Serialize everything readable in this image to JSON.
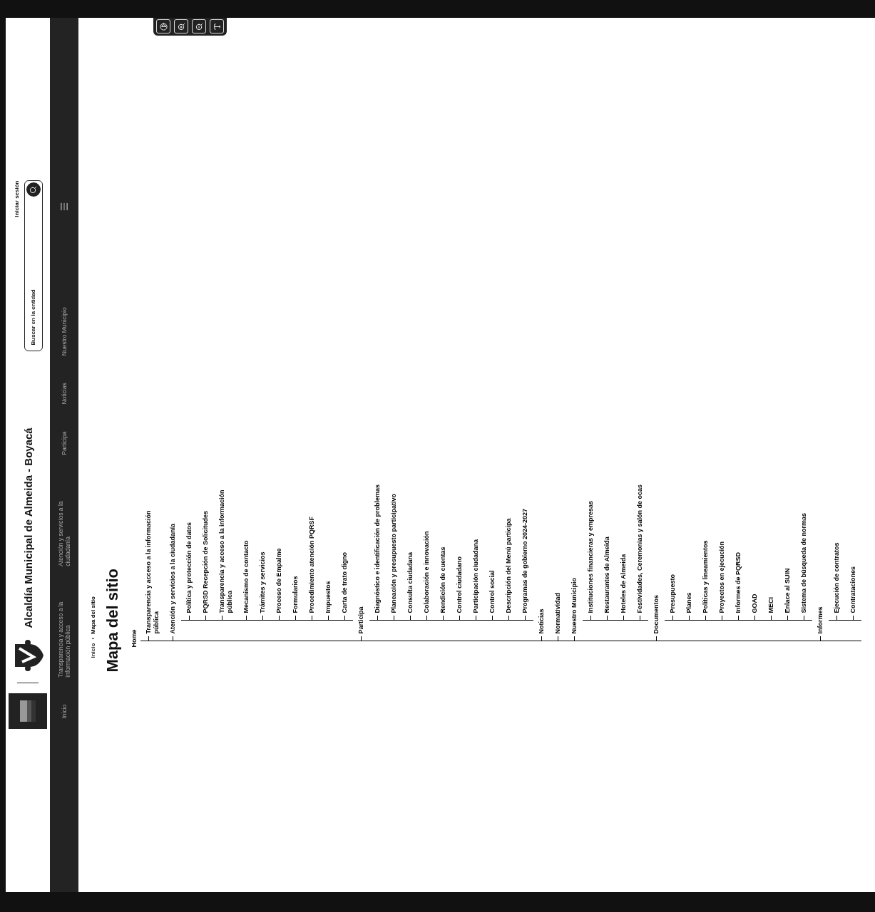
{
  "header": {
    "title": "Alcaldía Municipal de Almeida - Boyacá",
    "login": "Iniciar sesión",
    "search": {
      "placeholder": "Buscar en la entidad"
    }
  },
  "nav": {
    "items": [
      {
        "label": "Inicio"
      },
      {
        "label": "Transparencia y acceso a la información pública"
      },
      {
        "label": "Atención y servicios a la ciudadanía"
      },
      {
        "label": "Participa"
      },
      {
        "label": "Noticias"
      },
      {
        "label": "Nuestro Municipio"
      }
    ]
  },
  "breadcrumb": {
    "separator": "›",
    "items": [
      {
        "label": "Inicio",
        "selected": false
      },
      {
        "label": "Mapa del sitio",
        "selected": true
      }
    ]
  },
  "page_title": "Mapa del sitio",
  "sitemap": {
    "root": "Home",
    "items": [
      {
        "label": "Transparencia y acceso a la información pública",
        "children": []
      },
      {
        "label": "Atención y servicios a la ciudadanía",
        "children": [
          {
            "label": "Política y protección de datos",
            "children": []
          },
          {
            "label": "PQRSD Recepción de Solicitudes",
            "children": []
          },
          {
            "label": "Transparencia y acceso a la información pública",
            "children": []
          },
          {
            "label": "Mecanismo de contacto",
            "children": []
          },
          {
            "label": "Trámites y servicios",
            "children": []
          },
          {
            "label": "Proceso de Empalme",
            "children": []
          },
          {
            "label": "Formularios",
            "children": []
          },
          {
            "label": "Procedimiento atención PQRSF",
            "children": []
          },
          {
            "label": "Impuestos",
            "children": []
          },
          {
            "label": "Carta de trato digno",
            "children": []
          }
        ]
      },
      {
        "label": "Participa",
        "children": [
          {
            "label": "Diagnóstico e identificación de problemas",
            "children": []
          },
          {
            "label": "Planeación y presupuesto participativo",
            "children": []
          },
          {
            "label": "Consulta ciudadana",
            "children": []
          },
          {
            "label": "Colaboración e innovación",
            "children": []
          },
          {
            "label": "Rendición de cuentas",
            "children": []
          },
          {
            "label": "Control ciudadano",
            "children": []
          },
          {
            "label": "Participación ciudadana",
            "children": []
          },
          {
            "label": "Control social",
            "children": []
          },
          {
            "label": "Descripción del Menú participa",
            "children": []
          },
          {
            "label": "Programas de gobierno 2024-2027",
            "children": []
          }
        ]
      },
      {
        "label": "Noticias",
        "children": []
      },
      {
        "label": "Normatividad",
        "children": []
      },
      {
        "label": "Nuestro Municipio",
        "children": [
          {
            "label": "Instituciones financieras y empresas",
            "children": []
          },
          {
            "label": "Restaurantes de Almeida",
            "children": []
          },
          {
            "label": "Hoteles de Almeida",
            "children": []
          },
          {
            "label": "Festividades, Ceremonias y salón de ocas",
            "children": []
          }
        ]
      },
      {
        "label": "Documentos",
        "children": [
          {
            "label": "Presupuesto",
            "children": []
          },
          {
            "label": "Planes",
            "children": []
          },
          {
            "label": "Políticas y lineamientos",
            "children": []
          },
          {
            "label": "Proyectos en ejecución",
            "children": []
          },
          {
            "label": "Informes de PQRSD",
            "children": []
          },
          {
            "label": "GOAD",
            "children": []
          },
          {
            "label": "MECI",
            "children": []
          },
          {
            "label": "Enlace al SUIN",
            "children": []
          },
          {
            "label": "Sistema de búsqueda de normas",
            "children": []
          }
        ]
      },
      {
        "label": "Informes",
        "children": [
          {
            "label": "Ejecución de contratos",
            "children": []
          },
          {
            "label": "Contrataciones",
            "children": []
          }
        ]
      }
    ]
  }
}
